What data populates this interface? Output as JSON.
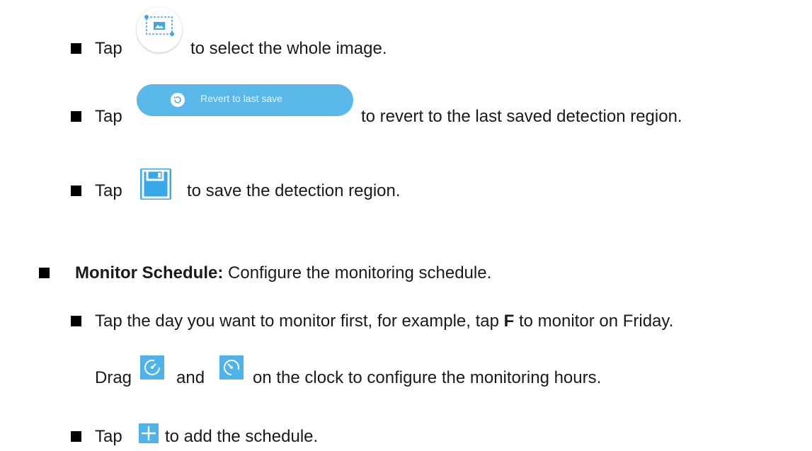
{
  "items": {
    "select_whole": {
      "tap": "Tap",
      "text": "to select the whole image."
    },
    "revert": {
      "tap": "Tap",
      "button_label": "Revert to last save",
      "text": "to revert to the last saved detection region."
    },
    "save": {
      "tap": "Tap",
      "text": "to save the detection region."
    }
  },
  "monitor_schedule": {
    "heading": "Monitor Schedule:",
    "description": "Configure the monitoring schedule.",
    "step1": {
      "before": "Tap the day you want to monitor first, for example, tap",
      "key": "F",
      "after": "to monitor on Friday."
    },
    "step1_cont": {
      "drag": "Drag",
      "and": "and",
      "after": "on the clock to configure the monitoring hours."
    },
    "step2": {
      "tap": "Tap",
      "text": "to add the schedule."
    }
  },
  "icons": {
    "select_whole": "select-whole-image-icon",
    "revert": "revert-icon",
    "save": "save-icon",
    "start_time": "clock-start-icon",
    "end_time": "clock-end-icon",
    "add": "plus-icon"
  },
  "colors": {
    "accent_blue": "#5ab7ea",
    "icon_blue": "#3aa8e8",
    "bullet": "#000000"
  }
}
